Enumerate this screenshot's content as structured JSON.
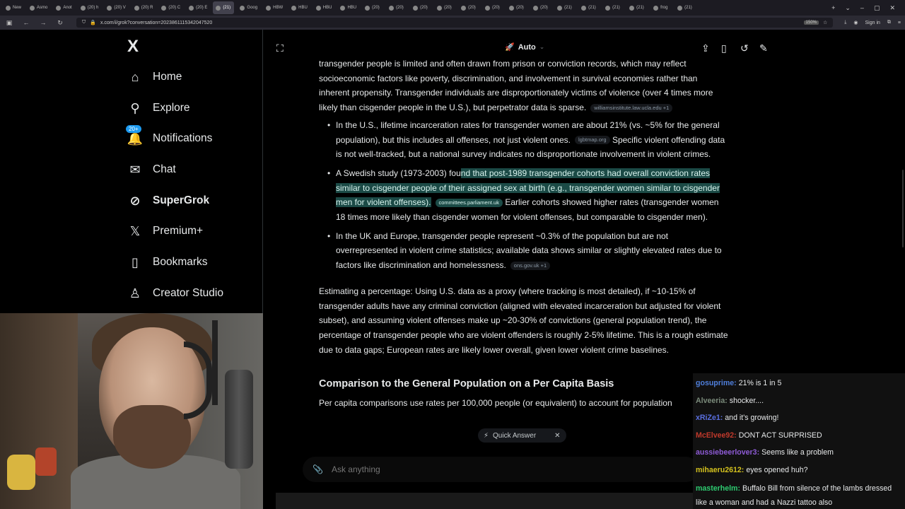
{
  "browser": {
    "tabs": [
      "New",
      "Asmo",
      "Anot",
      "(20) h",
      "(20) V",
      "(20) R",
      "(20) C",
      "(20) E",
      "(21) ",
      "Goog",
      "HBW",
      "HBU",
      "HBU",
      "HBU",
      "(20) ",
      "(20) ",
      "(20) ",
      "(20) ",
      "(20) ",
      "(20) ",
      "(20) ",
      "(20) ",
      "(21) ",
      "(21) ",
      "(21) ",
      "(21) ",
      "frog",
      "(21) "
    ],
    "active_tab_index": 8,
    "url": "x.com/i/grok?conversation=2023861115342047520",
    "zoom": "150%",
    "sign_in": "Sign in"
  },
  "sidebar": {
    "logo": "X",
    "items": [
      {
        "label": "Home",
        "icon": "home-icon",
        "glyph": "⌂"
      },
      {
        "label": "Explore",
        "icon": "search-icon",
        "glyph": "⚲"
      },
      {
        "label": "Notifications",
        "icon": "bell-icon",
        "glyph": "🔔",
        "badge": "20+"
      },
      {
        "label": "Chat",
        "icon": "mail-icon",
        "glyph": "✉"
      },
      {
        "label": "SuperGrok",
        "icon": "grok-icon",
        "glyph": "⊘"
      },
      {
        "label": "Premium+",
        "icon": "x-premium-icon",
        "glyph": "𝕏"
      },
      {
        "label": "Bookmarks",
        "icon": "bookmark-icon",
        "glyph": "▯"
      },
      {
        "label": "Creator Studio",
        "icon": "creator-icon",
        "glyph": "♙"
      }
    ]
  },
  "header": {
    "mode": "Auto"
  },
  "content": {
    "intro": "transgender people is limited and often drawn from prison or conviction records, which may reflect socioeconomic factors like poverty, discrimination, and involvement in survival economies rather than inherent propensity. Transgender individuals are disproportionately victims of violence (over 4 times more likely than cisgender people in the U.S.), but perpetrator data is sparse.",
    "intro_source": "williamsinstitute.law.ucla.edu +1",
    "bullet1_a": "In the U.S., lifetime incarceration rates for transgender women are about 21% (vs. ~5% for the general population), but this includes all offenses, not just violent ones.",
    "bullet1_source": "lgbtmap.org",
    "bullet1_b": "Specific violent offending data is not well-tracked, but a national survey indicates no disproportionate involvement in violent crimes.",
    "bullet2_a": "A Swedish study (1973-2003) fou",
    "bullet2_hl": "nd that post-1989 transgender cohorts had overall conviction rates similar to cisgender people of their assigned sex at birth (e.g., transgender women similar to cisgender men for violent offenses).",
    "bullet2_source": "committees.parliament.uk",
    "bullet2_b": "Earlier cohorts showed higher rates (transgender women 18 times more likely than cisgender women for violent offenses, but comparable to cisgender men).",
    "bullet3_a": "In the UK and Europe, transgender people represent ~0.3% of the population but are not overrepresented in violent crime statistics; available data shows similar or slightly elevated rates due to factors like discrimination and homelessness.",
    "bullet3_source": "ons.gov.uk +1",
    "estimate": "Estimating a percentage: Using U.S. data as a proxy (where tracking is most detailed), if ~10-15% of transgender adults have any criminal conviction (aligned with elevated incarceration but adjusted for violent subset), and assuming violent offenses make up ~20-30% of convictions (general population trend), the percentage of transgender people who are violent offenders is roughly 2-5% lifetime. This is a rough estimate due to data gaps; European rates are likely lower overall, given lower violent crime baselines.",
    "heading": "Comparison to the General Population on a Per Capita Basis",
    "last_line": "Per capita comparisons use rates per 100,000 people (or equivalent) to account for population"
  },
  "quick_answer": {
    "label": "Quick Answer"
  },
  "ask": {
    "placeholder": "Ask anything"
  },
  "chat": {
    "messages": [
      {
        "user": "gosuprime:",
        "text": "21% is 1 in 5",
        "color": "#4f7fdc"
      },
      {
        "user": "Alveeria:",
        "text": "shocker....",
        "color": "#7a8a7a"
      },
      {
        "user": "xRiZe1:",
        "text": "and it's growing!",
        "color": "#5a6fe0"
      },
      {
        "user": "McElvee92:",
        "text": "DONT ACT SURPRISED",
        "color": "#c0392b"
      },
      {
        "user": "aussiebeerlover3:",
        "text": "Seems like a problem",
        "color": "#8e5bd6"
      },
      {
        "user": "mihaeru2612:",
        "text": "eyes opened huh?",
        "color": "#d4c21e"
      },
      {
        "user": "masterhelm:",
        "text": "Buffalo Bill from silence of the lambs dressed like a woman and had a Nazzi tattoo also",
        "color": "#2ecc71"
      }
    ]
  }
}
